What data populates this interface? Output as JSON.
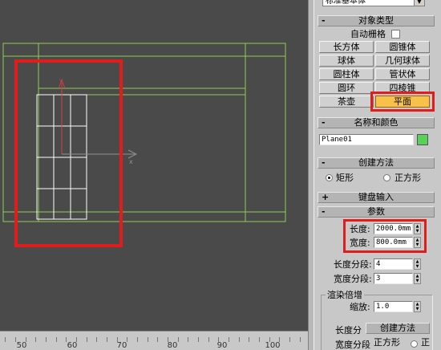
{
  "viewport": {
    "bg_color": "#4a4a4a",
    "wire_color": "#8fcf52",
    "plane_color": "#ffffff",
    "axis_x_label": "x",
    "axis_y_label": "y"
  },
  "ruler": {
    "ticks": [
      "50",
      "60",
      "70",
      "80",
      "90",
      "100"
    ]
  },
  "panel": {
    "dropdown_value": "标准基本体",
    "object_type": {
      "title": "对象类型",
      "autogrid_label": "自动栅格",
      "buttons": [
        "长方体",
        "圆锥体",
        "球体",
        "几何球体",
        "圆柱体",
        "管状体",
        "圆环",
        "四棱锥",
        "茶壶",
        "平面"
      ]
    },
    "name_color": {
      "title": "名称和颜色",
      "name_value": "Plane01",
      "swatch_color": "#57d157"
    },
    "creation_method": {
      "title": "创建方法",
      "rect_label": "矩形",
      "square_label": "正方形"
    },
    "keyboard_entry": {
      "title": "键盘输入"
    },
    "parameters": {
      "title": "参数",
      "length_label": "长度:",
      "length_value": "2000.0mm",
      "width_label": "宽度:",
      "width_value": "800.0mm",
      "length_segs_label": "长度分段:",
      "length_segs_value": "4",
      "width_segs_label": "宽度分段:",
      "width_segs_value": "3",
      "render_group_label": "渲染倍增",
      "scale_label": "缩放:",
      "scale_value": "1.0"
    },
    "ghost": {
      "length_seg_label": "长度分",
      "method_label": "创建方法",
      "width_seg_label": "宽度分段",
      "square_label": "正方形",
      "cut_label": "正"
    }
  },
  "highlight_color": "#e21b1b",
  "active_button_color": "#f7c24c"
}
